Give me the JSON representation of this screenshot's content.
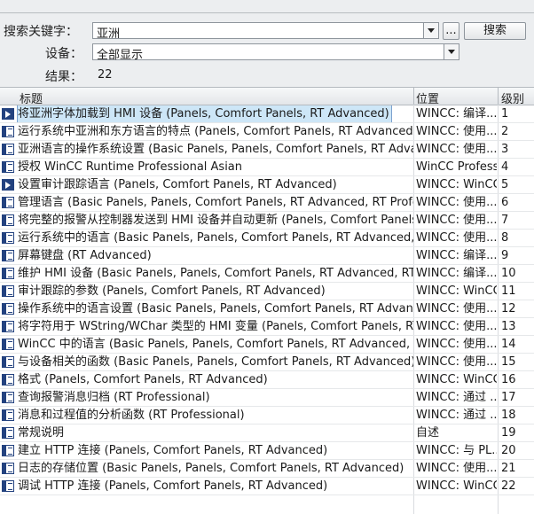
{
  "search": {
    "label": "搜索关键字：",
    "value": "亚洲",
    "button": "搜索",
    "browse": "..."
  },
  "device": {
    "label": "设备：",
    "value": "全部显示"
  },
  "result": {
    "label": "结果：",
    "count": "22"
  },
  "columns": {
    "title": "标题",
    "location": "位置",
    "level": "级别"
  },
  "rows": [
    {
      "icon": "page-arrow-icon",
      "title": "将亚洲字体加载到 HMI 设备 (Panels, Comfort Panels, RT Advanced)",
      "location": "WINCC: 编译...",
      "level": "1"
    },
    {
      "icon": "book-icon",
      "title": "运行系统中亚洲和东方语言的特点 (Panels, Comfort Panels, RT Advanced)",
      "location": "WINCC: 使用...",
      "level": "2"
    },
    {
      "icon": "book-icon",
      "title": "亚洲语言的操作系统设置 (Basic Panels, Panels, Comfort Panels, RT Advanced)",
      "location": "WINCC: 使用...",
      "level": "3"
    },
    {
      "icon": "book-icon",
      "title": "授权 WinCC Runtime Professional Asian",
      "location": "WinCC Professi...",
      "level": "4"
    },
    {
      "icon": "page-arrow-icon",
      "title": "设置审计跟踪语言 (Panels, Comfort Panels, RT Advanced)",
      "location": "WINCC: WinCC...",
      "level": "5"
    },
    {
      "icon": "book-icon",
      "title": "管理语言 (Basic Panels, Panels, Comfort Panels, RT Advanced, RT Professional)",
      "location": "WINCC: 使用...",
      "level": "6"
    },
    {
      "icon": "book-icon",
      "title": "将完整的报警从控制器发送到 HMI 设备并自动更新 (Panels, Comfort Panels)",
      "location": "WINCC: 使用...",
      "level": "7"
    },
    {
      "icon": "book-icon",
      "title": "运行系统中的语言 (Basic Panels, Panels, Comfort Panels, RT Advanced, RT Professional)",
      "location": "WINCC: 使用...",
      "level": "8"
    },
    {
      "icon": "book-icon",
      "title": "屏幕键盘 (RT Advanced)",
      "location": "WINCC: 编译...",
      "level": "9"
    },
    {
      "icon": "book-icon",
      "title": "维护 HMI 设备 (Basic Panels, Panels, Comfort Panels, RT Advanced, RT Professional)",
      "location": "WINCC: 编译...",
      "level": "10"
    },
    {
      "icon": "book-icon",
      "title": "审计跟踪的参数 (Panels, Comfort Panels, RT Advanced)",
      "location": "WINCC: WinCC...",
      "level": "11"
    },
    {
      "icon": "book-icon",
      "title": "操作系统中的语言设置 (Basic Panels, Panels, Comfort Panels, RT Advanced)",
      "location": "WINCC: 使用...",
      "level": "12"
    },
    {
      "icon": "book-icon",
      "title": "将字符用于 WString/WChar 类型的 HMI 变量 (Panels, Comfort Panels, RT Advanced)",
      "location": "WINCC: 使用...",
      "level": "13"
    },
    {
      "icon": "book-icon",
      "title": "WinCC 中的语言 (Basic Panels, Panels, Comfort Panels, RT Advanced, RT Professional)",
      "location": "WINCC: 使用...",
      "level": "14"
    },
    {
      "icon": "book-icon",
      "title": "与设备相关的函数 (Basic Panels, Panels, Comfort Panels, RT Advanced)",
      "location": "WINCC: 使用...",
      "level": "15"
    },
    {
      "icon": "book-icon",
      "title": "格式 (Panels, Comfort Panels, RT Advanced)",
      "location": "WINCC: WinCC...",
      "level": "16"
    },
    {
      "icon": "book-icon",
      "title": "查询报警消息归档 (RT Professional)",
      "location": "WINCC: 通过 ...",
      "level": "17"
    },
    {
      "icon": "book-icon",
      "title": "消息和过程值的分析函数 (RT Professional)",
      "location": "WINCC: 通过 ...",
      "level": "18"
    },
    {
      "icon": "book-icon",
      "title": "常规说明",
      "location": "自述",
      "level": "19"
    },
    {
      "icon": "book-icon",
      "title": "建立 HTTP 连接 (Panels, Comfort Panels, RT Advanced)",
      "location": "WINCC: 与 PL...",
      "level": "20"
    },
    {
      "icon": "book-icon",
      "title": "日志的存储位置 (Basic Panels, Panels, Comfort Panels, RT Advanced)",
      "location": "WINCC: 使用...",
      "level": "21"
    },
    {
      "icon": "book-icon",
      "title": "调试 HTTP 连接 (Panels, Comfort Panels, RT Advanced)",
      "location": "WINCC: WinCC...",
      "level": "22"
    }
  ],
  "selected_row": "1",
  "colors": {
    "selection": "#cde6f7",
    "icon": "#23427f"
  }
}
